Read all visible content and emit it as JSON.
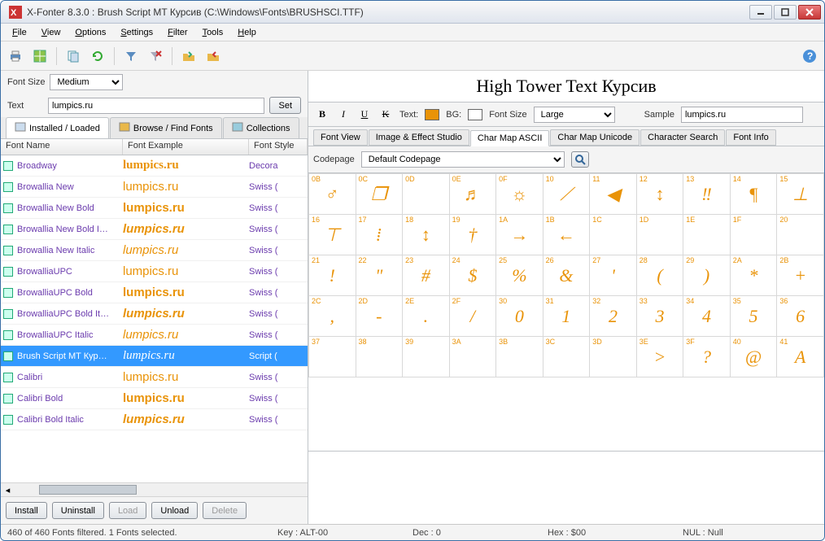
{
  "window": {
    "title": "X-Fonter 8.3.0  :  Brush Script MT Курсив (C:\\Windows\\Fonts\\BRUSHSCI.TTF)"
  },
  "menu": [
    "File",
    "View",
    "Options",
    "Settings",
    "Filter",
    "Tools",
    "Help"
  ],
  "left": {
    "fontsize_label": "Font Size",
    "fontsize_value": "Medium",
    "text_label": "Text",
    "text_value": "lumpics.ru",
    "set_label": "Set",
    "tabs": [
      "Installed / Loaded",
      "Browse / Find Fonts",
      "Collections"
    ],
    "headers": {
      "name": "Font Name",
      "example": "Font Example",
      "style": "Font Style"
    },
    "fonts": [
      {
        "name": "Broadway",
        "example": "lumpics.ru",
        "style": "Decora",
        "ex_style": "font-family:Impact;font-weight:700"
      },
      {
        "name": "Browallia New",
        "example": "lumpics.ru",
        "style": "Swiss ("
      },
      {
        "name": "Browallia New Bold",
        "example": "lumpics.ru",
        "style": "Swiss (",
        "ex_style": "font-weight:700"
      },
      {
        "name": "Browallia New Bold I…",
        "example": "lumpics.ru",
        "style": "Swiss (",
        "ex_style": "font-weight:700;font-style:italic"
      },
      {
        "name": "Browallia New Italic",
        "example": "lumpics.ru",
        "style": "Swiss (",
        "ex_style": "font-style:italic"
      },
      {
        "name": "BrowalliaUPC",
        "example": "lumpics.ru",
        "style": "Swiss ("
      },
      {
        "name": "BrowalliaUPC Bold",
        "example": "lumpics.ru",
        "style": "Swiss (",
        "ex_style": "font-weight:700"
      },
      {
        "name": "BrowalliaUPC Bold It…",
        "example": "lumpics.ru",
        "style": "Swiss (",
        "ex_style": "font-weight:700;font-style:italic"
      },
      {
        "name": "BrowalliaUPC Italic",
        "example": "lumpics.ru",
        "style": "Swiss (",
        "ex_style": "font-style:italic"
      },
      {
        "name": "Brush Script MT Кур…",
        "example": "lumpics.ru",
        "style": "Script (",
        "selected": true,
        "ex_style": "font-family:'Brush Script MT',cursive;font-style:italic"
      },
      {
        "name": "Calibri",
        "example": "lumpics.ru",
        "style": "Swiss ("
      },
      {
        "name": "Calibri Bold",
        "example": "lumpics.ru",
        "style": "Swiss (",
        "ex_style": "font-weight:700"
      },
      {
        "name": "Calibri Bold Italic",
        "example": "lumpics.ru",
        "style": "Swiss (",
        "ex_style": "font-weight:700;font-style:italic"
      }
    ],
    "actions": {
      "install": "Install",
      "uninstall": "Uninstall",
      "load": "Load",
      "unload": "Unload",
      "delete": "Delete"
    }
  },
  "right": {
    "preview_title": "High Tower Text Курсив",
    "fmt": {
      "text_label": "Text:",
      "bg_label": "BG:",
      "fontsize_label": "Font Size",
      "fontsize_value": "Large",
      "sample_label": "Sample",
      "sample_value": "lumpics.ru",
      "text_color": "#e99308",
      "bg_color": "#ffffff"
    },
    "tabs": [
      "Font View",
      "Image & Effect Studio",
      "Char Map ASCII",
      "Char Map Unicode",
      "Character Search",
      "Font Info"
    ],
    "active_tab": 2,
    "codepage_label": "Codepage",
    "codepage_value": "Default Codepage",
    "charmap": [
      [
        {
          "h": "0B",
          "c": "♂"
        },
        {
          "h": "0C",
          "c": "❐"
        },
        {
          "h": "0D",
          "c": ""
        },
        {
          "h": "0E",
          "c": "♬"
        },
        {
          "h": "0F",
          "c": "☼"
        },
        {
          "h": "10",
          "c": "⟋"
        },
        {
          "h": "11",
          "c": "◀"
        },
        {
          "h": "12",
          "c": "↕"
        },
        {
          "h": "13",
          "c": "‼"
        },
        {
          "h": "14",
          "c": "¶"
        },
        {
          "h": "15",
          "c": "⊥"
        }
      ],
      [
        {
          "h": "16",
          "c": "⊤"
        },
        {
          "h": "17",
          "c": "⁞"
        },
        {
          "h": "18",
          "c": "↕"
        },
        {
          "h": "19",
          "c": "†"
        },
        {
          "h": "1A",
          "c": "→"
        },
        {
          "h": "1B",
          "c": "←"
        },
        {
          "h": "1C",
          "c": ""
        },
        {
          "h": "1D",
          "c": ""
        },
        {
          "h": "1E",
          "c": ""
        },
        {
          "h": "1F",
          "c": ""
        },
        {
          "h": "20",
          "c": ""
        }
      ],
      [
        {
          "h": "21",
          "c": "!"
        },
        {
          "h": "22",
          "c": "\""
        },
        {
          "h": "23",
          "c": "#"
        },
        {
          "h": "24",
          "c": "$"
        },
        {
          "h": "25",
          "c": "%"
        },
        {
          "h": "26",
          "c": "&"
        },
        {
          "h": "27",
          "c": "'"
        },
        {
          "h": "28",
          "c": "("
        },
        {
          "h": "29",
          "c": ")"
        },
        {
          "h": "2A",
          "c": "*"
        },
        {
          "h": "2B",
          "c": "+"
        }
      ],
      [
        {
          "h": "2C",
          "c": ","
        },
        {
          "h": "2D",
          "c": "-"
        },
        {
          "h": "2E",
          "c": "."
        },
        {
          "h": "2F",
          "c": "/"
        },
        {
          "h": "30",
          "c": "0"
        },
        {
          "h": "31",
          "c": "1"
        },
        {
          "h": "32",
          "c": "2"
        },
        {
          "h": "33",
          "c": "3"
        },
        {
          "h": "34",
          "c": "4"
        },
        {
          "h": "35",
          "c": "5"
        },
        {
          "h": "36",
          "c": "6"
        }
      ],
      [
        {
          "h": "37",
          "c": ""
        },
        {
          "h": "38",
          "c": ""
        },
        {
          "h": "39",
          "c": ""
        },
        {
          "h": "3A",
          "c": ""
        },
        {
          "h": "3B",
          "c": ""
        },
        {
          "h": "3C",
          "c": ""
        },
        {
          "h": "3D",
          "c": ""
        },
        {
          "h": "3E",
          "c": ">"
        },
        {
          "h": "3F",
          "c": "?"
        },
        {
          "h": "40",
          "c": "@"
        },
        {
          "h": "41",
          "c": "A"
        }
      ]
    ]
  },
  "status": {
    "left": "460 of 460 Fonts filtered.  1 Fonts selected.",
    "key": "Key : ALT-00",
    "dec": "Dec : 0",
    "hex": "Hex : $00",
    "nul": "NUL : Null"
  }
}
